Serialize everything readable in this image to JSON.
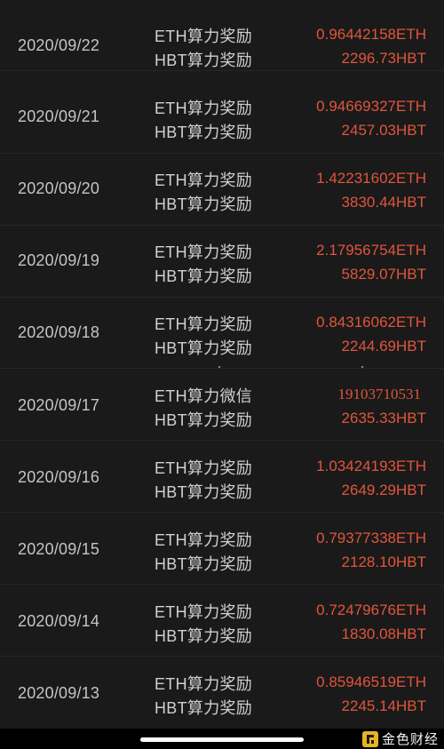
{
  "rows": [
    {
      "date": "2020/09/22",
      "label_eth": "ETH算力奖励",
      "label_hbt": "HBT算力奖励",
      "amount_eth": "0.96442158ETH",
      "amount_hbt": "2296.73HBT"
    },
    {
      "date": "2020/09/21",
      "label_eth": "ETH算力奖励",
      "label_hbt": "HBT算力奖励",
      "amount_eth": "0.94669327ETH",
      "amount_hbt": "2457.03HBT"
    },
    {
      "date": "2020/09/20",
      "label_eth": "ETH算力奖励",
      "label_hbt": "HBT算力奖励",
      "amount_eth": "1.42231602ETH",
      "amount_hbt": "3830.44HBT"
    },
    {
      "date": "2020/09/19",
      "label_eth": "ETH算力奖励",
      "label_hbt": "HBT算力奖励",
      "amount_eth": "2.17956754ETH",
      "amount_hbt": "5829.07HBT"
    },
    {
      "date": "2020/09/18",
      "label_eth": "ETH算力奖励",
      "label_hbt": "HBT算力奖励",
      "amount_eth": "0.84316062ETH",
      "amount_hbt": "2244.69HBT"
    },
    {
      "date": "2020/09/17",
      "label_eth": "ETH算力微信",
      "label_hbt": "HBT算力奖励",
      "amount_eth": "19103710531",
      "amount_hbt": "2635.33HBT"
    },
    {
      "date": "2020/09/16",
      "label_eth": "ETH算力奖励",
      "label_hbt": "HBT算力奖励",
      "amount_eth": "1.03424193ETH",
      "amount_hbt": "2649.29HBT"
    },
    {
      "date": "2020/09/15",
      "label_eth": "ETH算力奖励",
      "label_hbt": "HBT算力奖励",
      "amount_eth": "0.79377338ETH",
      "amount_hbt": "2128.10HBT"
    },
    {
      "date": "2020/09/14",
      "label_eth": "ETH算力奖励",
      "label_hbt": "HBT算力奖励",
      "amount_eth": "0.72479676ETH",
      "amount_hbt": "1830.08HBT"
    },
    {
      "date": "2020/09/13",
      "label_eth": "ETH算力奖励",
      "label_hbt": "HBT算力奖励",
      "amount_eth": "0.85946519ETH",
      "amount_hbt": "2245.14HBT"
    }
  ],
  "watermark": {
    "text": "金色财经",
    "logo_icon": "jinse-logo-icon"
  },
  "colors": {
    "background": "#1a1a1a",
    "amount": "#e0553c",
    "text": "#c8c8c8"
  }
}
